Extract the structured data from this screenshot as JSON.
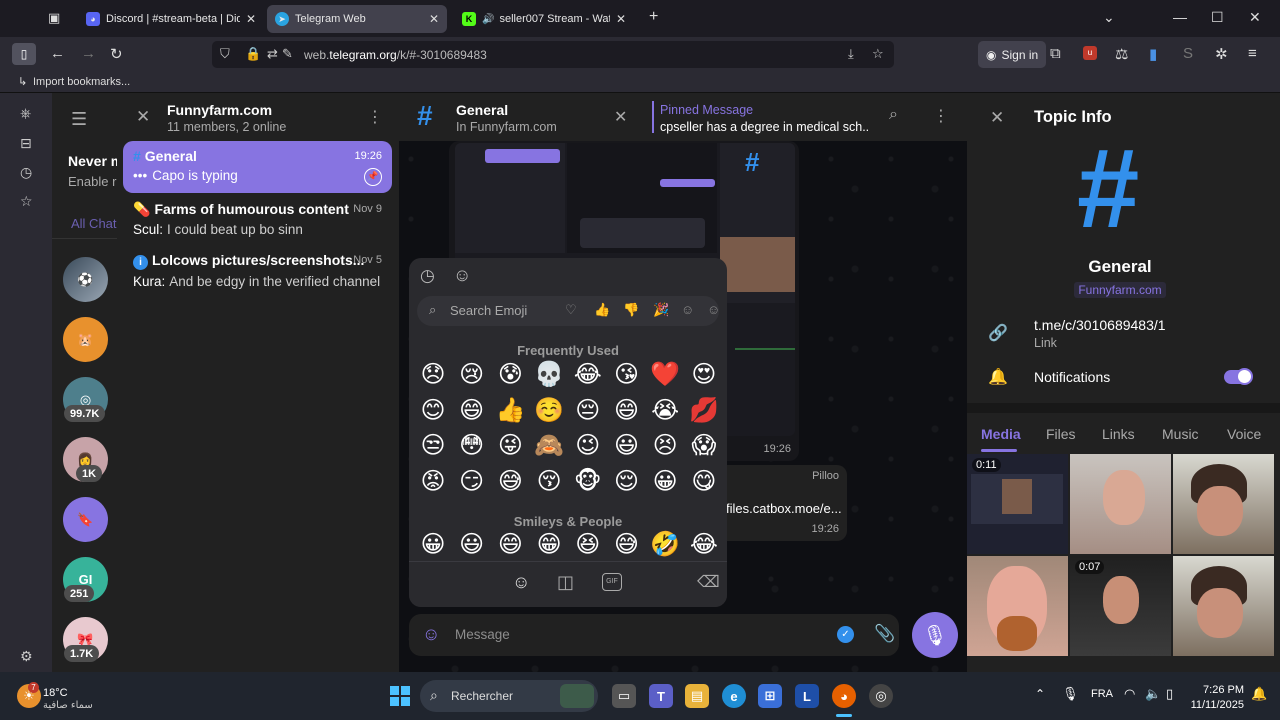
{
  "browser": {
    "tabs": [
      {
        "title": "Discord | #stream-beta | Diddy",
        "icon": "discord-icon"
      },
      {
        "title": "Telegram Web",
        "icon": "telegram-icon"
      },
      {
        "title": "seller007 Stream - Watch Li",
        "icon": "kick-icon"
      }
    ],
    "url_prefix": "web.",
    "url_domain": "telegram.org",
    "url_path": "/k/#-3010689483",
    "sign_in": "Sign in",
    "import_bookmarks": "Import bookmarks..."
  },
  "chatlist_peek": {
    "title": "Never m",
    "subtitle": "Enable r",
    "tab": "All Chat"
  },
  "folders": {
    "badges": [
      "99.7K",
      "1K",
      "251",
      "1.7K"
    ],
    "gi_initials": "GI"
  },
  "group": {
    "title": "Funnyfarm.com",
    "subtitle": "11 members, 2 online"
  },
  "topics": [
    {
      "name": "General",
      "message": "Capo is typing",
      "date": "19:26",
      "icon": "hash-icon"
    },
    {
      "name": "Farms of humourous content",
      "sender": "Scul:",
      "message": "I could beat up bo sinn",
      "date": "Nov 9",
      "icon": "pill-icon"
    },
    {
      "name": "Lolcows pictures/screenshots...",
      "sender": "Kura:",
      "message": "And be edgy in the verified channel",
      "date": "Nov 5",
      "icon": "info-icon"
    }
  ],
  "chat_header": {
    "title": "General",
    "subtitle": "In Funnyfarm.com",
    "pinned_label": "Pinned Message",
    "pinned_text": "cpseller has a degree in medical sch..."
  },
  "messages": [
    {
      "time": "19:26"
    },
    {
      "sender": "Pilloo",
      "text": "files.catbox.moe/e...",
      "time": "19:26"
    }
  ],
  "emoji_panel": {
    "search_placeholder": "Search Emoji",
    "sections": [
      "Frequently Used",
      "Smileys & People"
    ],
    "frequent": [
      "😞",
      "😢",
      "😰",
      "💀",
      "😂",
      "😘",
      "❤️",
      "😍",
      "😊",
      "😄",
      "👍",
      "☺️",
      "😔",
      "😄",
      "😭",
      "💋",
      "😒",
      "😳",
      "😜",
      "🙈",
      "😉",
      "😃",
      "😣",
      "😱",
      "😡",
      "😏",
      "😅",
      "😚",
      "🐵",
      "😌",
      "😀",
      "😋"
    ],
    "smileys": [
      "😀",
      "😃",
      "😄",
      "😁",
      "😆",
      "😅",
      "🤣",
      "😂"
    ]
  },
  "composer": {
    "placeholder": "Message"
  },
  "info": {
    "title": "Topic Info",
    "topic_name": "General",
    "group_link": "Funnyfarm.com",
    "link": "t.me/c/3010689483/1",
    "link_caption": "Link",
    "notifications": "Notifications",
    "tabs": [
      "Media",
      "Files",
      "Links",
      "Music",
      "Voice"
    ],
    "media_durations": [
      "0:11",
      "0:07"
    ]
  },
  "taskbar": {
    "temperature": "18°C",
    "weather": "سماء صافية",
    "weather_badge": "7",
    "search": "Rechercher",
    "lang": "FRA",
    "time": "7:26 PM",
    "date": "11/11/2025"
  },
  "colors": {
    "accent": "#8774e1",
    "link_blue": "#3390ec"
  }
}
